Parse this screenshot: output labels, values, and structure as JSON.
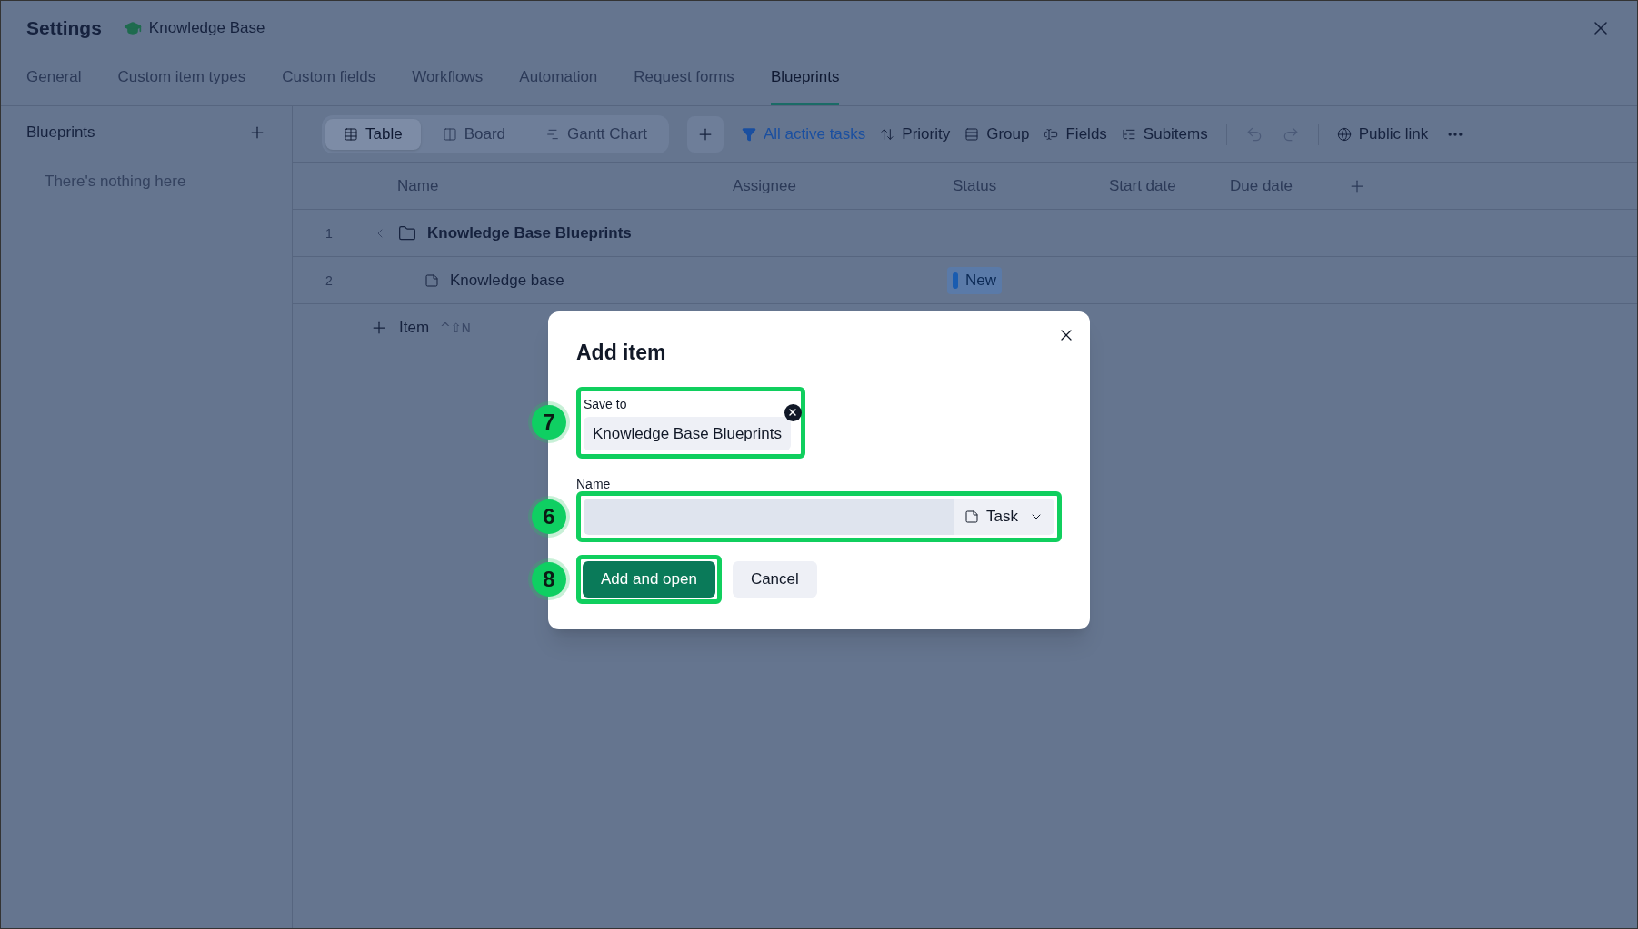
{
  "window": {
    "title": "Settings",
    "workspace": "Knowledge Base"
  },
  "tabs": [
    {
      "label": "General",
      "selected": false
    },
    {
      "label": "Custom item types",
      "selected": false
    },
    {
      "label": "Custom fields",
      "selected": false
    },
    {
      "label": "Workflows",
      "selected": false
    },
    {
      "label": "Automation",
      "selected": false
    },
    {
      "label": "Request forms",
      "selected": false
    },
    {
      "label": "Blueprints",
      "selected": true
    }
  ],
  "sidebar": {
    "title": "Blueprints",
    "empty_text": "There's nothing here"
  },
  "toolbar": {
    "views": [
      {
        "label": "Table",
        "kind": "table",
        "selected": true
      },
      {
        "label": "Board",
        "kind": "board",
        "selected": false
      },
      {
        "label": "Gantt Chart",
        "kind": "gantt",
        "selected": false
      }
    ],
    "filter": "All active tasks",
    "actions": [
      {
        "label": "Priority",
        "kind": "priority"
      },
      {
        "label": "Group",
        "kind": "group"
      },
      {
        "label": "Fields",
        "kind": "fields"
      },
      {
        "label": "Subitems",
        "kind": "subitems"
      }
    ],
    "public_link": "Public link"
  },
  "table": {
    "columns": [
      "Name",
      "Assignee",
      "Status",
      "Start date",
      "Due date"
    ],
    "rows": [
      {
        "number": "1",
        "kind": "folder",
        "name": "Knowledge Base Blueprints"
      },
      {
        "number": "2",
        "kind": "task",
        "name": "Knowledge base",
        "status": "New"
      }
    ],
    "add_item": {
      "label": "Item",
      "shortcut": "^⇧N"
    }
  },
  "dialog": {
    "title": "Add item",
    "save_to": {
      "label": "Save to",
      "value": "Knowledge Base Blueprints",
      "callout": "7"
    },
    "name": {
      "label": "Name",
      "type": "Task",
      "callout": "6"
    },
    "buttons": [
      {
        "label": "Add and open",
        "kind": "primary",
        "callout": "8"
      },
      {
        "label": "Cancel",
        "kind": "secondary"
      }
    ]
  }
}
